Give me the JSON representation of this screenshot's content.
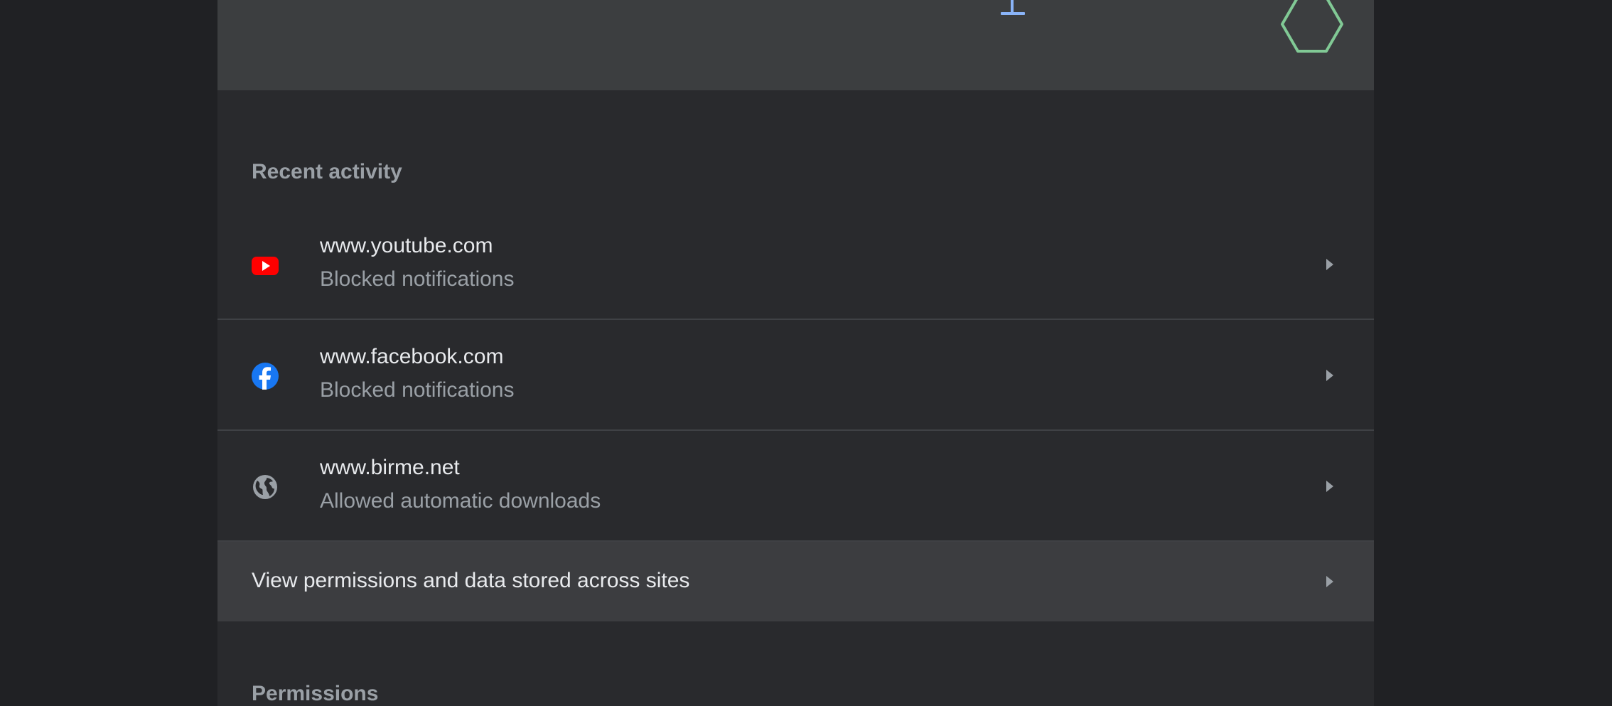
{
  "recent_activity": {
    "title": "Recent activity",
    "items": [
      {
        "site": "www.youtube.com",
        "status": "Blocked notifications",
        "icon": "youtube-icon"
      },
      {
        "site": "www.facebook.com",
        "status": "Blocked notifications",
        "icon": "facebook-icon"
      },
      {
        "site": "www.birme.net",
        "status": "Allowed automatic downloads",
        "icon": "globe-icon"
      }
    ]
  },
  "view_all": {
    "label": "View permissions and data stored across sites",
    "icon": "chevron-right-icon"
  },
  "permissions": {
    "title": "Permissions"
  },
  "colors": {
    "page_bg": "#202124",
    "card_bg": "#292a2d",
    "header_bg": "#3c3e40",
    "youtube_red": "#ff0000",
    "facebook_blue": "#1877f2",
    "accent_blue": "#8ab4f8",
    "accent_green": "#81c995"
  }
}
